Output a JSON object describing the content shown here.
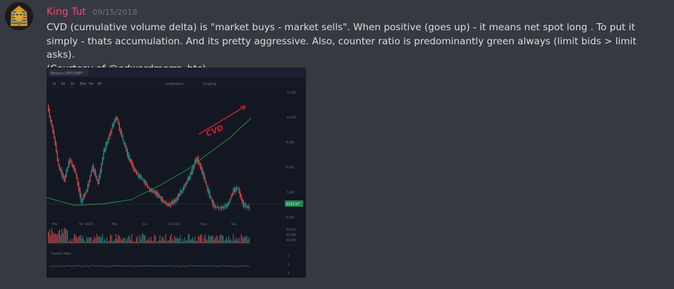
{
  "message": {
    "author": "King Tut",
    "timestamp": "09/15/2018",
    "text_line1": "CVD (cumulative volume delta) is \"market buys - market sells\". When positive (goes up) - it means net spot long . To put it simply - thats accumulation. And its pretty aggressive. Also, counter ratio is predominantly green always (limit bids > limit asks).",
    "text_line2": "(Courtesy of @edwardmorra_btc)"
  },
  "attachment": {
    "exchange_tab": "Binance | BTC/USDT",
    "timeframes": [
      "1d",
      "4h",
      "1h",
      "15m",
      "5m",
      "6T"
    ],
    "toolbar_center": "Candlesticks",
    "toolbar_right": "Scripting",
    "annotation": "CVD",
    "price_axis": [
      "11,000",
      "10,000",
      "9,000",
      "8,000",
      "7,000",
      "6,000"
    ],
    "current_price": "6331.67",
    "month_labels": [
      "Mar",
      "Apr 2018",
      "May",
      "Jun",
      "Jul 2018",
      "Aug",
      "Sep"
    ],
    "volume_axis": [
      "60,000",
      "40,000",
      "20,000"
    ],
    "counter_label": "Counter Ratio",
    "colors": {
      "up": "#26a69a",
      "down": "#ef5350",
      "cvd": "#1f9c3f",
      "annotation": "#cc1f2b"
    }
  }
}
